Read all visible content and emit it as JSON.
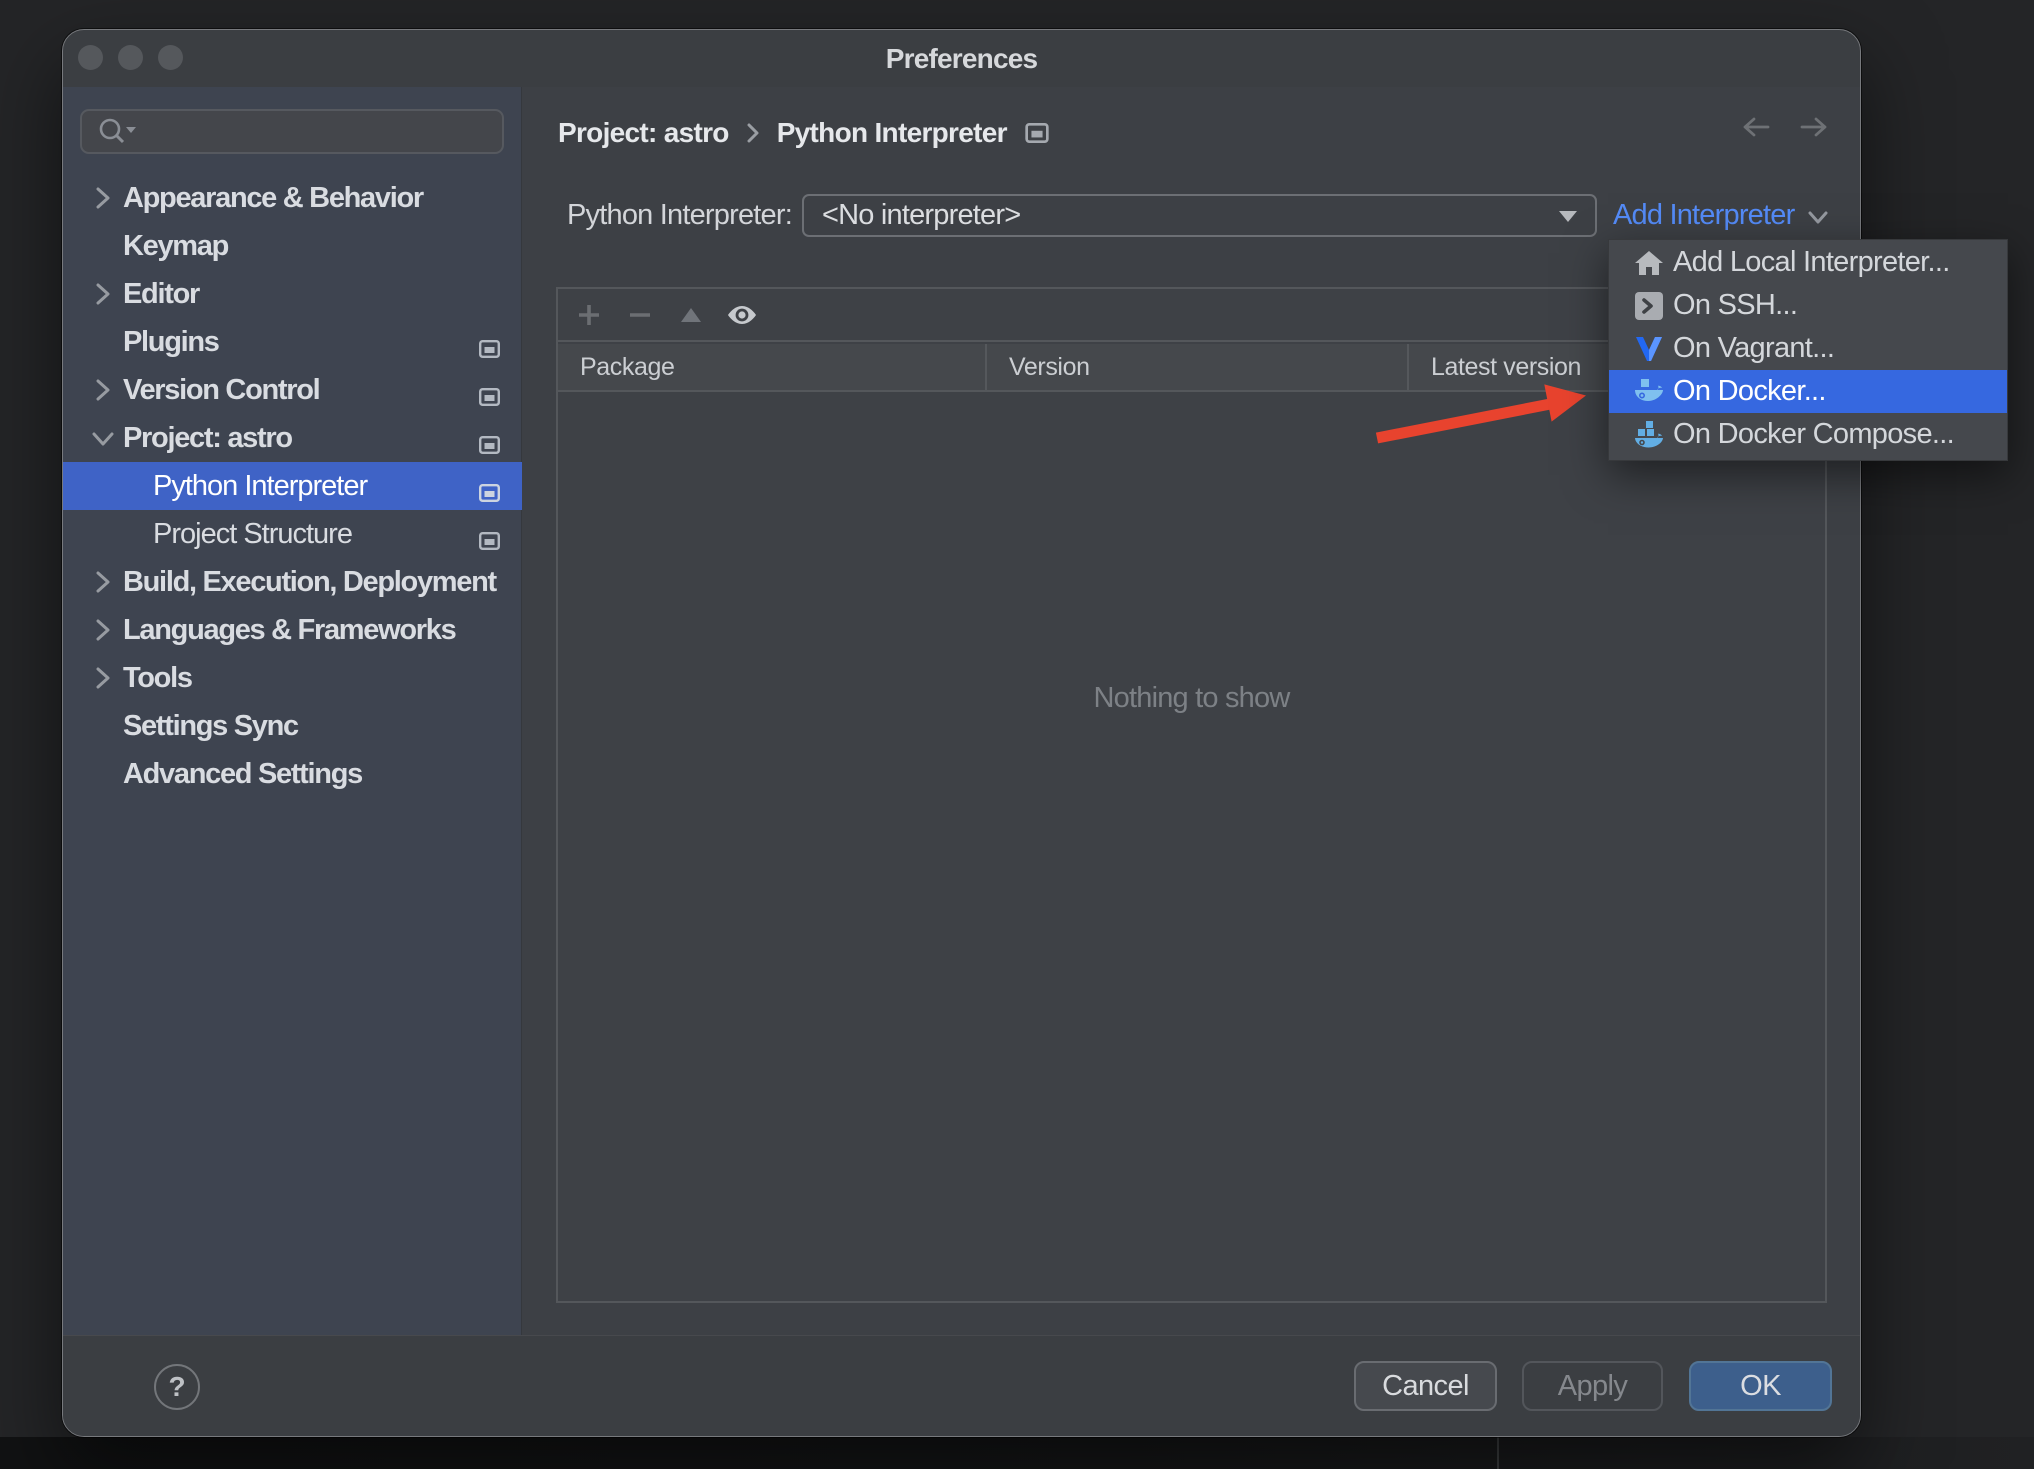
{
  "window": {
    "title": "Preferences"
  },
  "sidebar": {
    "search": {
      "placeholder": ""
    },
    "items": [
      {
        "label": "Appearance & Behavior",
        "state": "collapsed"
      },
      {
        "label": "Keymap"
      },
      {
        "label": "Editor",
        "state": "collapsed"
      },
      {
        "label": "Plugins",
        "external": true
      },
      {
        "label": "Version Control",
        "state": "collapsed",
        "external": true
      },
      {
        "label": "Project: astro",
        "state": "expanded",
        "external": true
      },
      {
        "label": "Python Interpreter",
        "child": true,
        "selected": true,
        "external": true
      },
      {
        "label": "Project Structure",
        "child": true,
        "external": true
      },
      {
        "label": "Build, Execution, Deployment",
        "state": "collapsed"
      },
      {
        "label": "Languages & Frameworks",
        "state": "collapsed"
      },
      {
        "label": "Tools",
        "state": "collapsed"
      },
      {
        "label": "Settings Sync"
      },
      {
        "label": "Advanced Settings"
      }
    ]
  },
  "breadcrumb": {
    "items": [
      "Project: astro",
      "Python Interpreter"
    ],
    "separator": "›"
  },
  "interpreter": {
    "label": "Python Interpreter:",
    "value": "<No interpreter>",
    "add_link": "Add Interpreter"
  },
  "add_menu": {
    "items": [
      {
        "label": "Add Local Interpreter...",
        "icon": "home-icon"
      },
      {
        "label": "On SSH...",
        "icon": "ssh-icon"
      },
      {
        "label": "On Vagrant...",
        "icon": "vagrant-icon"
      },
      {
        "label": "On Docker...",
        "icon": "docker-icon",
        "selected": true
      },
      {
        "label": "On Docker Compose...",
        "icon": "docker-compose-icon"
      }
    ]
  },
  "table": {
    "columns": [
      "Package",
      "Version",
      "Latest version"
    ],
    "toolbar": [
      "add",
      "remove",
      "upgrade",
      "show-early-releases"
    ],
    "empty_text": "Nothing to show"
  },
  "footer": {
    "help_label": "?",
    "cancel_label": "Cancel",
    "apply_label": "Apply",
    "ok_label": "OK"
  },
  "colors": {
    "selection_blue": "#3f63c6",
    "menu_highlight_blue": "#3668e0",
    "link_blue": "#548bf7",
    "ok_button_blue": "#3d5f8c",
    "annotation_arrow_red": "#e8432e",
    "docker_blue": "#5fa8e0",
    "vagrant_blue": "#2268f2"
  }
}
